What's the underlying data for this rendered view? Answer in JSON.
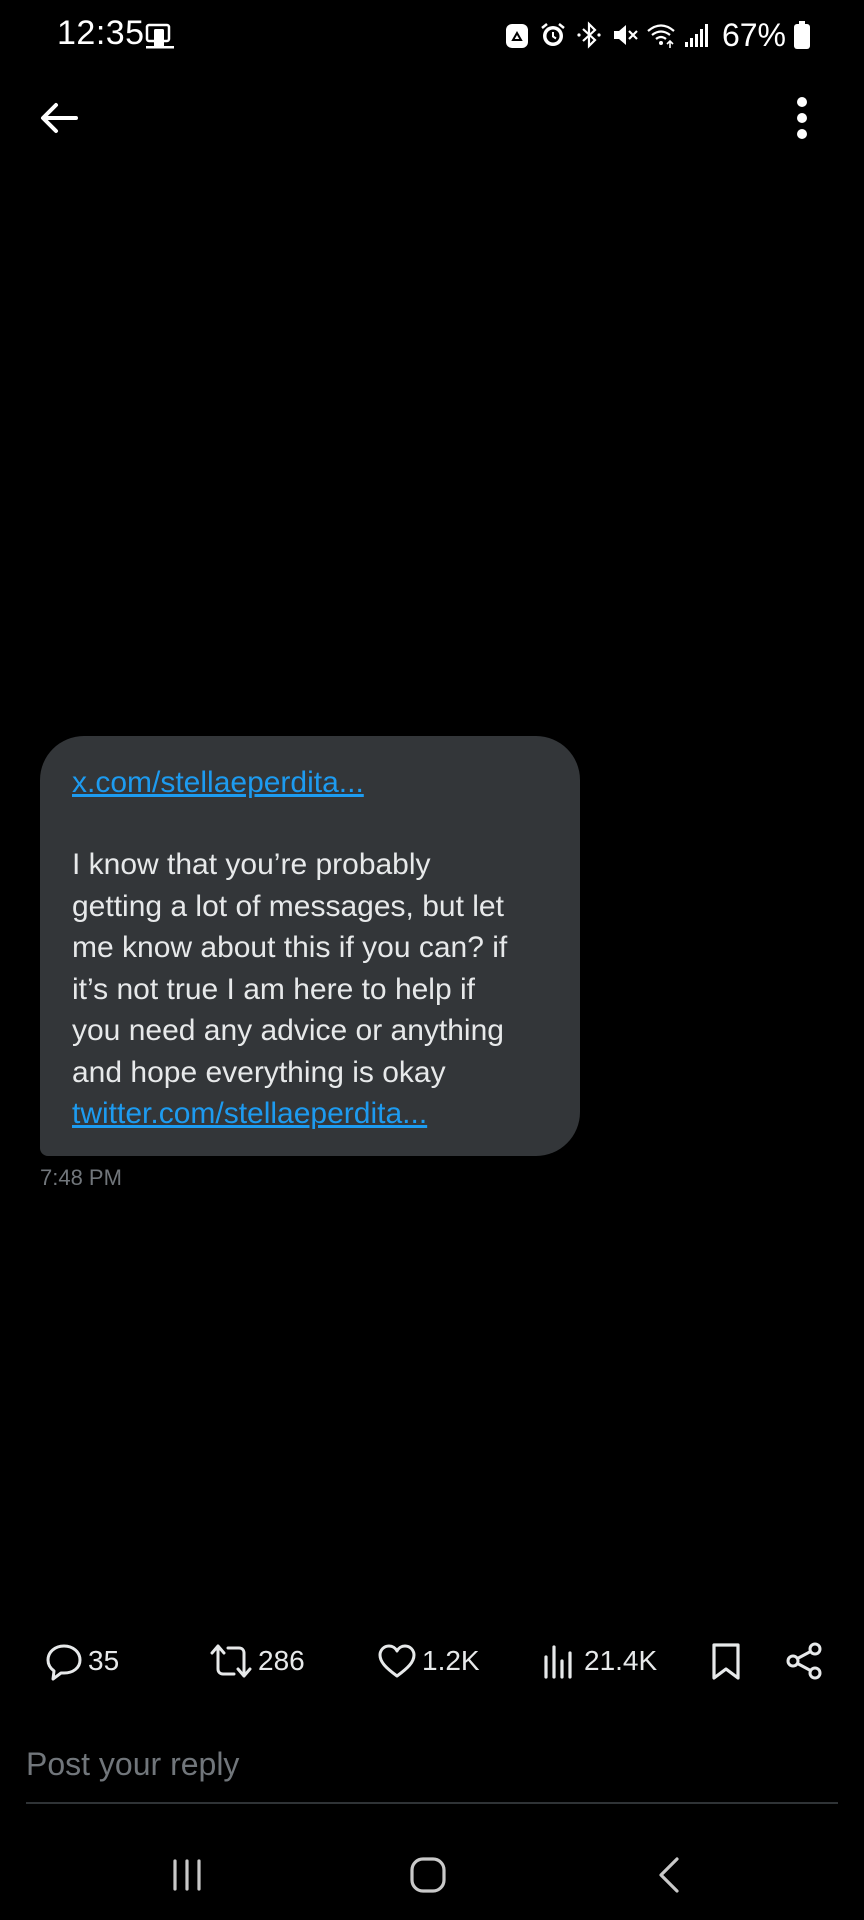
{
  "status_bar": {
    "time": "12:35",
    "battery_percent": "67%",
    "icons": [
      "screen-mirror-icon",
      "recycle-icon",
      "alarm-icon",
      "bluetooth-icon",
      "mute-icon",
      "wifi-icon",
      "signal-icon",
      "battery-icon"
    ]
  },
  "header": {
    "back_icon": "arrow-left-icon",
    "menu_icon": "more-vertical-icon"
  },
  "message": {
    "link_1": "x.com/stellaeperdita...",
    "body": "I know that you’re probably\ngetting a lot of messages, but let\nme know about this if you can? if\nit’s not true I am here to help if\nyou need any advice or anything\nand hope everything is okay",
    "link_2": "twitter.com/stellaeperdita...",
    "timestamp": "7:48 PM"
  },
  "actions": {
    "replies": "35",
    "reposts": "286",
    "likes": "1.2K",
    "views": "21.4K"
  },
  "reply": {
    "placeholder": "Post your reply"
  },
  "colors": {
    "background": "#000000",
    "bubble": "#333639",
    "link": "#1d9bf0",
    "muted_text": "#71767b"
  }
}
